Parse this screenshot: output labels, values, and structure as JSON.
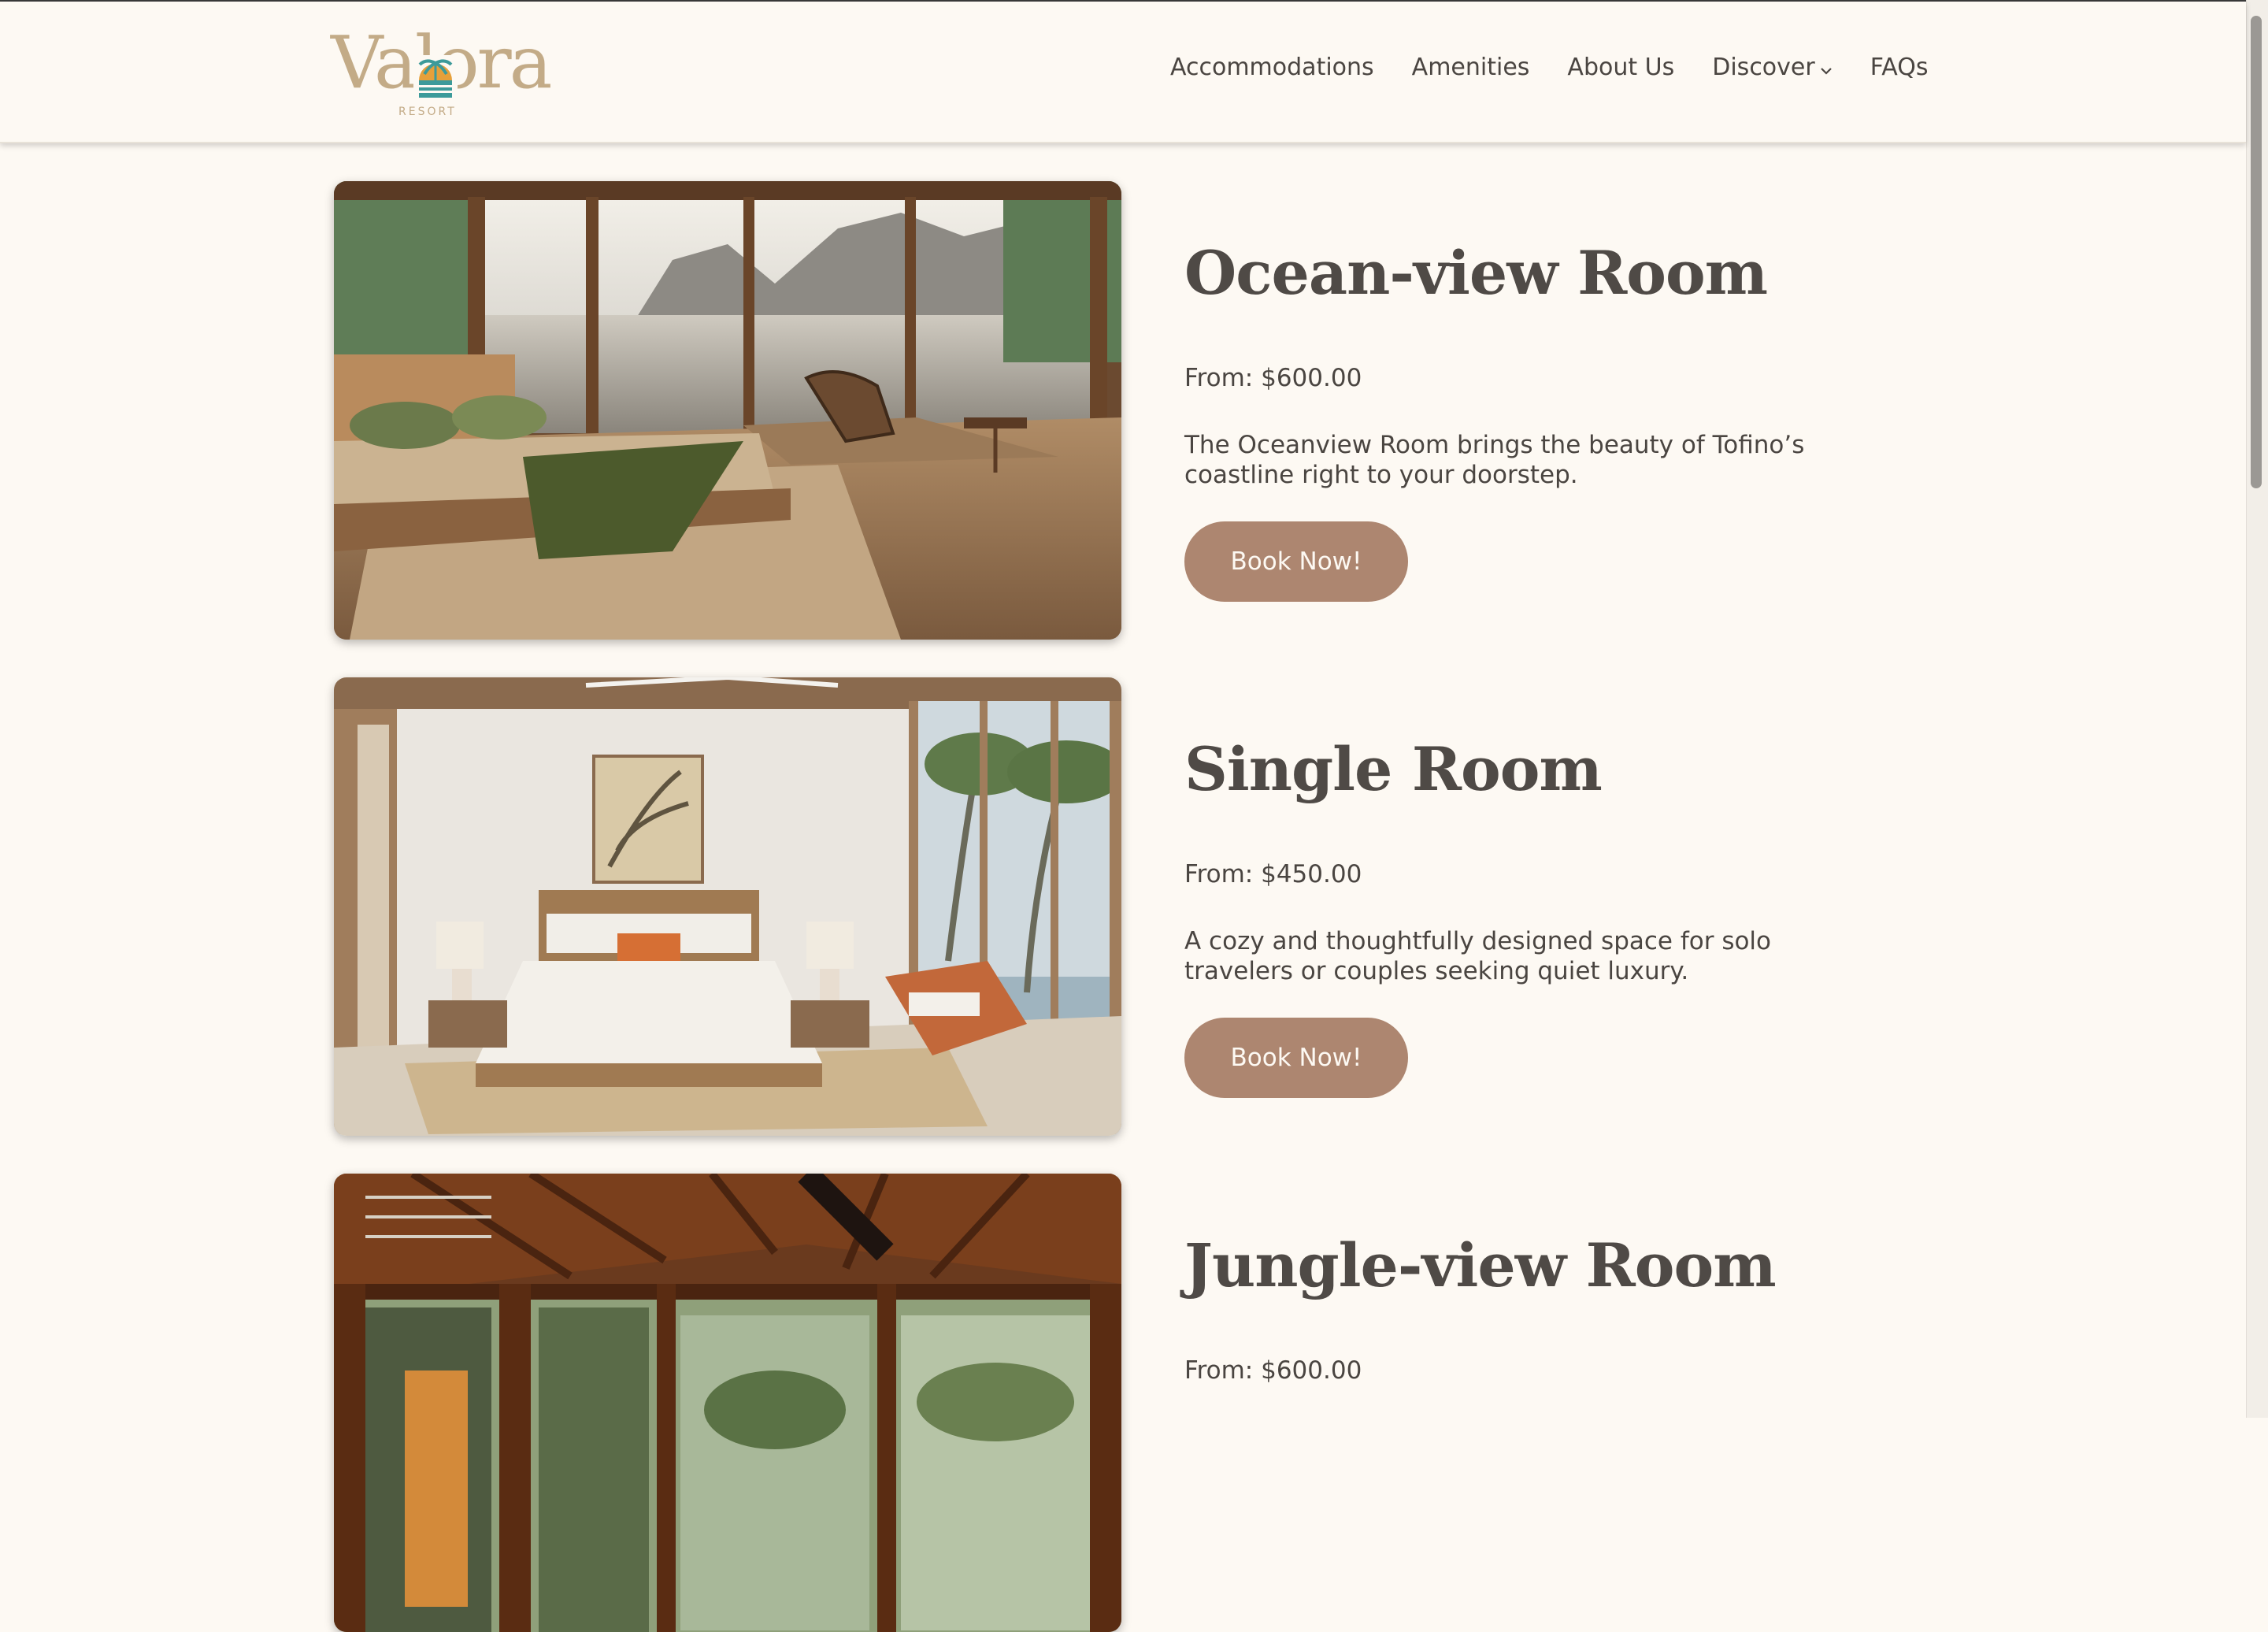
{
  "header": {
    "logo": {
      "wordmark": "Valora",
      "subtitle": "RESORT"
    },
    "nav": [
      {
        "label": "Accommodations"
      },
      {
        "label": "Amenities"
      },
      {
        "label": "About Us"
      },
      {
        "label": "Discover",
        "has_dropdown": true
      },
      {
        "label": "FAQs"
      }
    ]
  },
  "rooms": [
    {
      "title": "Ocean-view Room",
      "price": "From: $600.00",
      "description": "The Oceanview Room brings the beauty of Tofino’s coastline right to your doorstep.",
      "button_label": "Book Now!",
      "image": "ocean-view-bedroom-photo"
    },
    {
      "title": "Single Room",
      "price": "From: $450.00",
      "description": "A cozy and thoughtfully designed space for solo travelers or couples seeking quiet luxury.",
      "button_label": "Book Now!",
      "image": "single-bedroom-photo"
    },
    {
      "title": "Jungle-view Room",
      "price": "From: $600.00",
      "image": "jungle-view-room-photo"
    }
  ],
  "icons": {
    "dropdown": "chevron-down-icon",
    "logo_mark": "palm-sun-icon"
  },
  "colors": {
    "background": "#fdf9f3",
    "brand_gold": "#c3ab87",
    "brand_teal": "#3c9a9a",
    "brand_orange": "#e6a03a",
    "button": "#ad8670",
    "text": "#4a4541"
  }
}
